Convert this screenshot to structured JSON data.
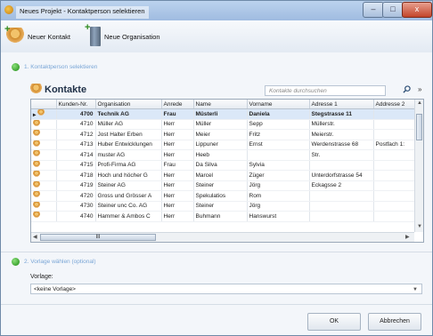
{
  "window": {
    "title": "Neues Projekt - Kontaktperson selektieren",
    "controls": {
      "minimize": "–",
      "maximize": "□",
      "close": "x"
    }
  },
  "toolbar": {
    "new_contact": "Neuer Kontakt",
    "new_org": "Neue Organisation"
  },
  "step1": {
    "label": "1. Kontaktperson selektieren"
  },
  "contacts": {
    "title": "Kontakte",
    "search_placeholder": "Kontakte durchsuchen",
    "columns": [
      "",
      "Kunden-Nr.",
      "Organisation",
      "Anrede",
      "Name",
      "Vorname",
      "Adresse 1",
      "Addresse 2"
    ],
    "rows": [
      {
        "kunden_nr": "4700",
        "organisation": "Technik AG",
        "anrede": "Frau",
        "name": "Müsterli",
        "vorname": "Daniela",
        "adresse1": "Stegstrasse 11",
        "adresse2": ""
      },
      {
        "kunden_nr": "4710",
        "organisation": "Müller AG",
        "anrede": "Herr",
        "name": "Müller",
        "vorname": "Sepp",
        "adresse1": "Müllerstr.",
        "adresse2": ""
      },
      {
        "kunden_nr": "4712",
        "organisation": "Jost Halter Erben",
        "anrede": "Herr",
        "name": "Meier",
        "vorname": "Fritz",
        "adresse1": "Meierstr.",
        "adresse2": ""
      },
      {
        "kunden_nr": "4713",
        "organisation": "Huber Entwicklungen",
        "anrede": "Herr",
        "name": "Lippuner",
        "vorname": "Ernst",
        "adresse1": "Werdenstrasse 68",
        "adresse2": "Postfach 1:"
      },
      {
        "kunden_nr": "4714",
        "organisation": "muster AG",
        "anrede": "Herr",
        "name": "Heeb",
        "vorname": "",
        "adresse1": "Str.",
        "adresse2": ""
      },
      {
        "kunden_nr": "4715",
        "organisation": "Profi-Firma AG",
        "anrede": "Frau",
        "name": "Da Silva",
        "vorname": "Sylvia",
        "adresse1": "",
        "adresse2": ""
      },
      {
        "kunden_nr": "4718",
        "organisation": "Hoch und höcher G",
        "anrede": "Herr",
        "name": "Marcel",
        "vorname": "Züger",
        "adresse1": "Unterdorfstrasse 54",
        "adresse2": ""
      },
      {
        "kunden_nr": "4719",
        "organisation": "Steiner AG",
        "anrede": "Herr",
        "name": "Steiner",
        "vorname": "Jörg",
        "adresse1": "Eckagsse 2",
        "adresse2": ""
      },
      {
        "kunden_nr": "4720",
        "organisation": "Gross und Grösser A",
        "anrede": "Herr",
        "name": "Spekulatios",
        "vorname": "Rom",
        "adresse1": "",
        "adresse2": ""
      },
      {
        "kunden_nr": "4730",
        "organisation": "Steiner unc Co. AG",
        "anrede": "Herr",
        "name": "Steiner",
        "vorname": "Jörg",
        "adresse1": "",
        "adresse2": ""
      },
      {
        "kunden_nr": "4740",
        "organisation": "Hammer & Ambos C",
        "anrede": "Herr",
        "name": "Buhmann",
        "vorname": "Hanswurst",
        "adresse1": "",
        "adresse2": ""
      }
    ],
    "hscroll_thumb": "III"
  },
  "step2": {
    "label": "2. Vorlage wählen (optional)"
  },
  "vorlage": {
    "label": "Vorlage:",
    "value": "<keine Vorlage>"
  },
  "buttons": {
    "ok": "OK",
    "cancel": "Abbrechen"
  }
}
